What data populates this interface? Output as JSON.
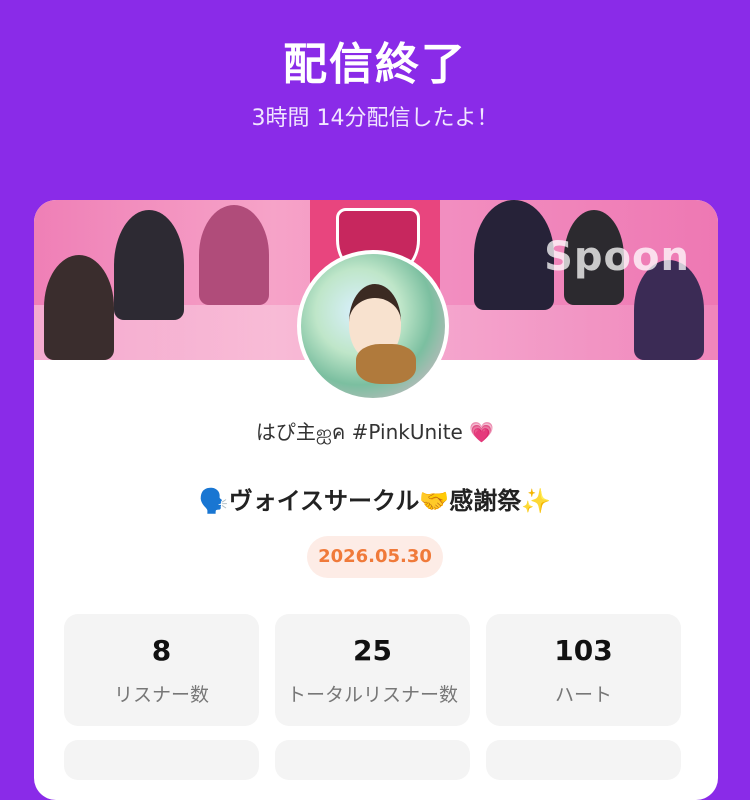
{
  "header": {
    "title": "配信終了",
    "subtitle": "3時間 14分配信したよ！"
  },
  "banner": {
    "watermark": "Spoon"
  },
  "profile": {
    "username": "はぴ主ஐค #PinkUnite",
    "heart": "💗",
    "stream_title": "🗣️ヴォイスサークル🤝感謝祭✨",
    "date": "2026.05.30"
  },
  "stats": [
    {
      "value": "8",
      "label": "リスナー数"
    },
    {
      "value": "25",
      "label": "トータルリスナー数"
    },
    {
      "value": "103",
      "label": "ハート"
    }
  ],
  "colors": {
    "background": "#8a2be8",
    "badge_text": "#f07a3a",
    "badge_bg": "#fdece6"
  }
}
